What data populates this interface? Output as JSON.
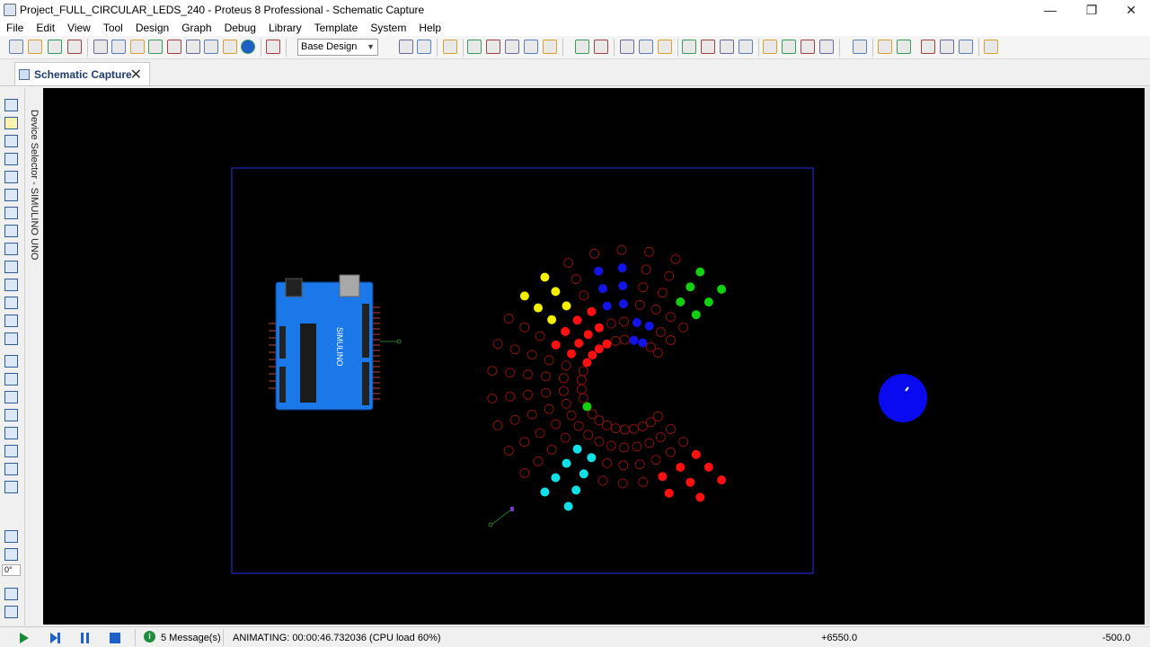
{
  "window": {
    "title": "Project_FULL_CIRCULAR_LEDS_240 - Proteus 8 Professional - Schematic Capture",
    "minimize": "—",
    "restore": "❐",
    "close": "✕"
  },
  "menu": [
    "File",
    "Edit",
    "View",
    "Tool",
    "Design",
    "Graph",
    "Debug",
    "Library",
    "Template",
    "System",
    "Help"
  ],
  "toolbar": {
    "design_select": "Base Design"
  },
  "tab": {
    "label": "Schematic Capture",
    "close": "✕"
  },
  "device_selector": {
    "label": "Device Selector - SIMULINO UNO",
    "angle": "0°"
  },
  "status": {
    "messages": "5 Message(s)",
    "animation": "ANIMATING: 00:00:46.732036 (CPU load 60%)",
    "x": "+6550.0",
    "y": "-500.0"
  },
  "board": {
    "brand": "SIMULINO",
    "board_color": "#1a78e8"
  },
  "colors": {
    "canvas": "#000000",
    "sheet_border": "#1f1f9a",
    "led_off": "#8a1010",
    "red": "#ff1010",
    "yellow": "#f5f000",
    "blue": "#1414e8",
    "green": "#10d010",
    "cyan": "#10e0e8"
  }
}
